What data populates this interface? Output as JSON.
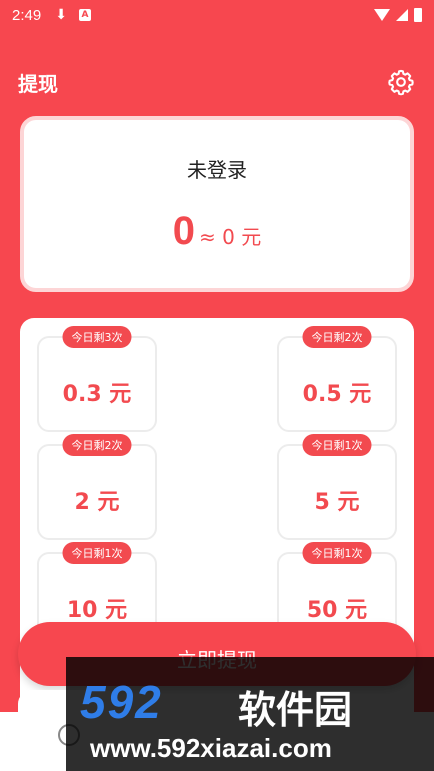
{
  "status_bar": {
    "time": "2:49",
    "download_glyph": "⬇",
    "app_glyph": "A"
  },
  "header": {
    "title": "提现",
    "settings_icon": "gear-icon"
  },
  "balance": {
    "login_status": "未登录",
    "points": "0",
    "approx": "≈ 0 元"
  },
  "options": [
    {
      "badge": "今日剩3次",
      "amount": "0.3 元"
    },
    {
      "badge": "今日剩2次",
      "amount": "0.5 元"
    },
    {
      "badge": "今日剩2次",
      "amount": "2 元"
    },
    {
      "badge": "今日剩1次",
      "amount": "5 元"
    },
    {
      "badge": "今日剩1次",
      "amount": "10 元"
    },
    {
      "badge": "今日剩1次",
      "amount": "50 元"
    }
  ],
  "withdraw_button": {
    "label": "立即提现"
  },
  "watermark": {
    "logo": "592",
    "name": "软件园",
    "url": "www.592xiazai.com"
  },
  "colors": {
    "primary": "#f7474f",
    "accent": "#f24a4f",
    "card_border": "#fdd5d6"
  }
}
